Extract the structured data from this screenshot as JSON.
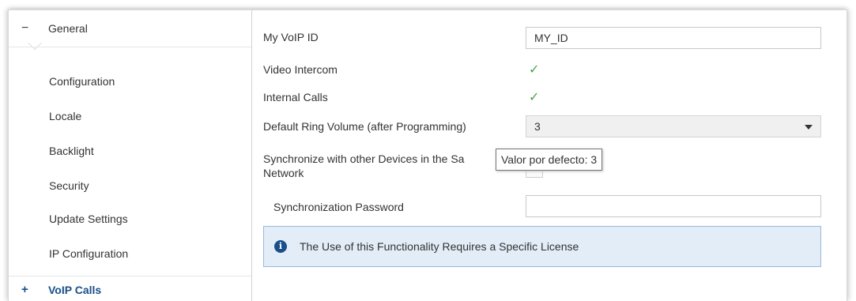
{
  "sidebar": {
    "header": {
      "expander": "−",
      "label": "General"
    },
    "items": [
      {
        "label": "Configuration"
      },
      {
        "label": "Locale"
      },
      {
        "label": "Backlight"
      },
      {
        "label": "Security"
      },
      {
        "label": "Update Settings"
      },
      {
        "label": "IP Configuration"
      }
    ],
    "footer": {
      "expander": "+",
      "label": "VoIP Calls"
    }
  },
  "form": {
    "voip_id": {
      "label": "My VoIP ID",
      "value": "MY_ID"
    },
    "video_intercom": {
      "label": "Video Intercom",
      "checked": true,
      "check_glyph": "✓"
    },
    "internal_calls": {
      "label": "Internal Calls",
      "checked": true,
      "check_glyph": "✓"
    },
    "ring_volume": {
      "label": "Default Ring Volume (after Programming)",
      "selected": "3"
    },
    "synchronize": {
      "label_line1": "Synchronize with other Devices in the Sa",
      "label_line2": "Network"
    },
    "sync_password": {
      "label": "Synchronization Password",
      "value": ""
    },
    "info": {
      "icon": "info-icon",
      "text": "The Use of this Functionality Requires a Specific License"
    }
  },
  "tooltip": {
    "text": "Valor por defecto: 3"
  },
  "colors": {
    "accent": "#1a4f8a",
    "check": "#4aa24a",
    "info_bg": "#e3edf7",
    "info_border": "#9ab9d8"
  }
}
